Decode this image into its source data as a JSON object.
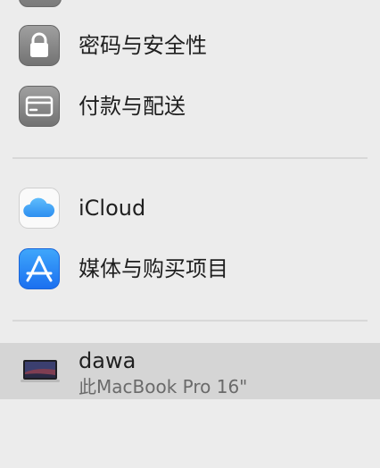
{
  "items": [
    {
      "label": "密码与安全性",
      "icon": "lock-icon"
    },
    {
      "label": "付款与配送",
      "icon": "credit-card-icon"
    },
    {
      "label": "iCloud",
      "icon": "icloud-icon"
    },
    {
      "label": "媒体与购买项目",
      "icon": "app-store-icon"
    }
  ],
  "device": {
    "name": "dawa",
    "model": "此MacBook Pro 16\""
  },
  "colors": {
    "background": "#ececec",
    "selected_row": "#d5d5d5",
    "divider": "#d8d8d8",
    "icloud_blue": "#39a4f4",
    "app_store_blue": "#2f8cf7"
  }
}
